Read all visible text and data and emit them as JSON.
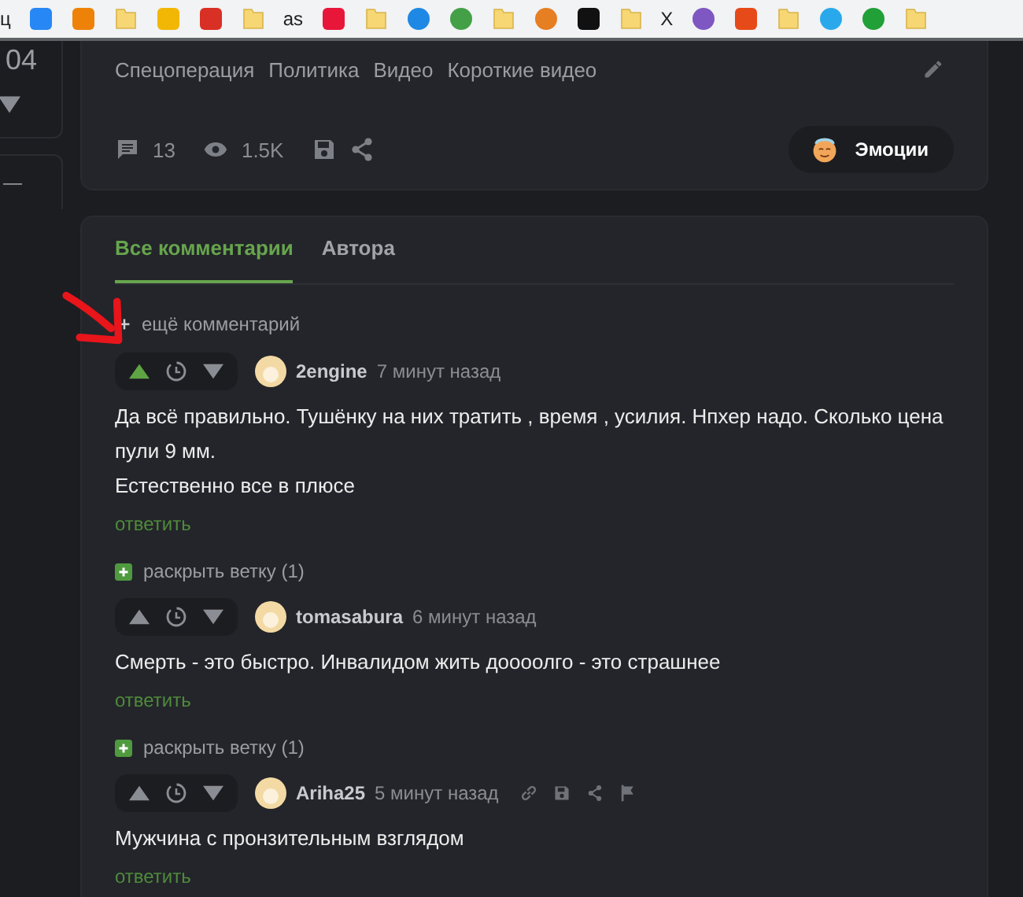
{
  "bookmarks": [
    {
      "kind": "text",
      "label": "ц"
    },
    {
      "kind": "tile",
      "color": "#2787f5"
    },
    {
      "kind": "tile",
      "color": "#ee8208"
    },
    {
      "kind": "folder"
    },
    {
      "kind": "tile",
      "color": "#f2b705"
    },
    {
      "kind": "tile",
      "color": "#d93025"
    },
    {
      "kind": "folder"
    },
    {
      "kind": "text",
      "label": "as"
    },
    {
      "kind": "tile",
      "color": "#e8173a"
    },
    {
      "kind": "folder"
    },
    {
      "kind": "round",
      "color": "#1e88e5"
    },
    {
      "kind": "round",
      "color": "#43a047"
    },
    {
      "kind": "folder"
    },
    {
      "kind": "round",
      "color": "#e67e22"
    },
    {
      "kind": "tile",
      "color": "#111111"
    },
    {
      "kind": "folder"
    },
    {
      "kind": "text",
      "label": "X"
    },
    {
      "kind": "round",
      "color": "#7e57c2"
    },
    {
      "kind": "tile",
      "color": "#e64a19"
    },
    {
      "kind": "folder"
    },
    {
      "kind": "round",
      "color": "#29a9eb"
    },
    {
      "kind": "round",
      "color": "#21a038"
    },
    {
      "kind": "folder"
    }
  ],
  "rail": {
    "rating": "04",
    "collapse": "—"
  },
  "post": {
    "tags": [
      "Спецоперация",
      "Политика",
      "Видео",
      "Короткие видео"
    ],
    "comments_count": "13",
    "views": "1.5K",
    "emotions_button": "Эмоции"
  },
  "comments_panel": {
    "tabs": [
      {
        "label": "Все комментарии",
        "selected": true
      },
      {
        "label": "Автора",
        "selected": false
      }
    ],
    "more_link": "ещё комментарий",
    "items": [
      {
        "kind": "comment",
        "author": "2engine",
        "time": "7 минут назад",
        "upvoted": true,
        "actions": false,
        "paragraphs": [
          "Да всё правильно. Тушёнку на них тратить , время , усилия. Нпхер надо. Сколько цена пули 9 мм.",
          "Естественно все в плюсе"
        ],
        "reply": "ответить"
      },
      {
        "kind": "expand",
        "label": "раскрыть ветку (1)"
      },
      {
        "kind": "comment",
        "author": "tomasabura",
        "time": "6 минут назад",
        "upvoted": false,
        "actions": false,
        "paragraphs": [
          "Смерть - это быстро. Инвалидом жить доооолго - это страшнее"
        ],
        "reply": "ответить"
      },
      {
        "kind": "expand",
        "label": "раскрыть ветку (1)"
      },
      {
        "kind": "comment",
        "author": "Ariha25",
        "time": "5 минут назад",
        "upvoted": false,
        "actions": true,
        "paragraphs": [
          "Мужчина с пронзительным взглядом"
        ],
        "reply": "ответить"
      }
    ]
  }
}
